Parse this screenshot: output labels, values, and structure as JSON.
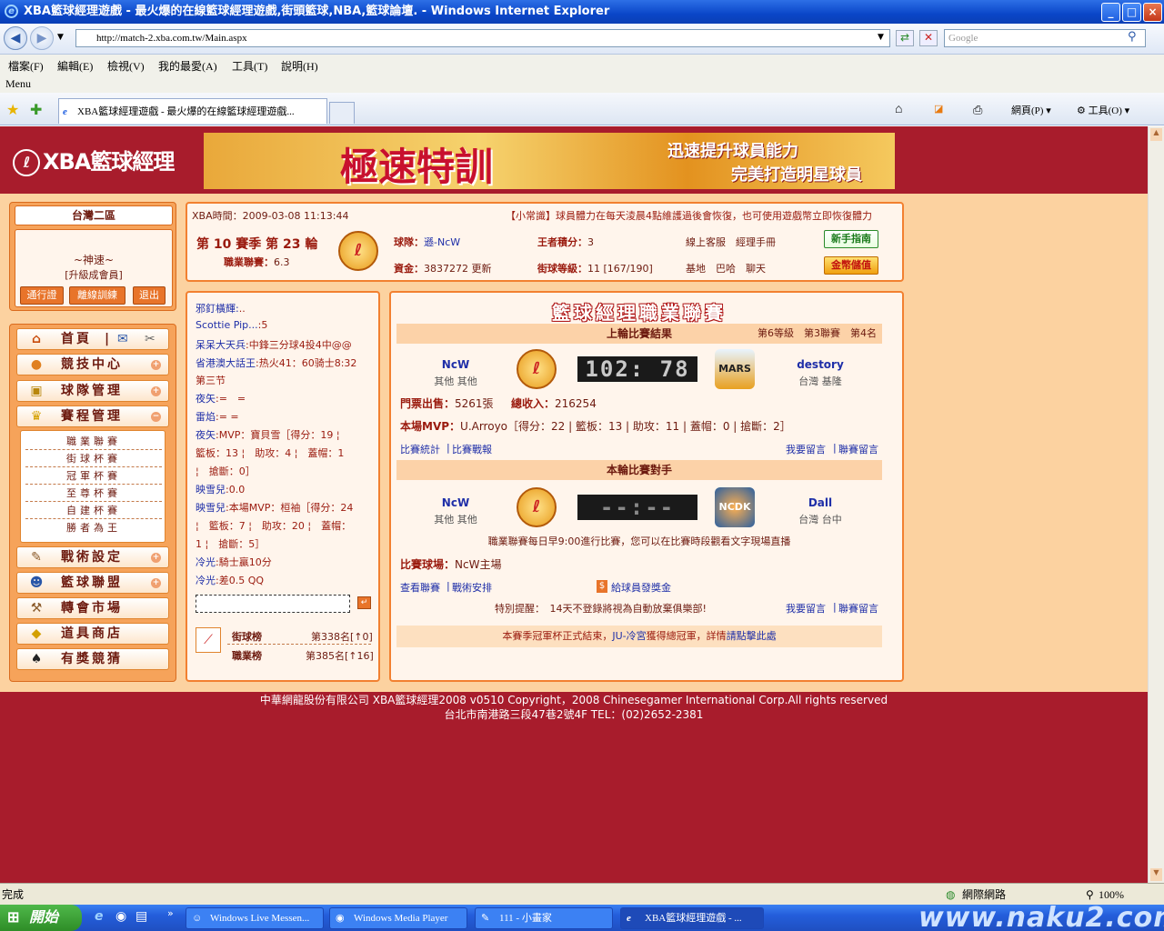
{
  "window": {
    "title": "XBA籃球經理遊戲 - 最火爆的在線籃球經理遊戲,街頭籃球,NBA,籃球論壇. - Windows Internet Explorer",
    "url": "http://match-2.xba.com.tw/Main.aspx",
    "search_placeholder": "Google",
    "menu": [
      "檔案(F)",
      "編輯(E)",
      "檢視(V)",
      "我的最愛(A)",
      "工具(T)",
      "說明(H)"
    ],
    "menu_label": "Menu",
    "tab_title": "XBA籃球經理遊戲 - 最火爆的在線籃球經理遊戲...",
    "toolbar": {
      "page": "網頁(P)",
      "tools": "工具(O)"
    }
  },
  "site": {
    "logo_text": "XBA籃球經理",
    "banner": {
      "title": "極速特訓",
      "line1": "迅速提升球員能力",
      "line2": "完美打造明星球員"
    }
  },
  "user": {
    "server": "台灣二區",
    "name": "~神速~",
    "level": "[升級成會員]",
    "buttons": [
      "通行證",
      "離線訓練",
      "退出"
    ]
  },
  "sidebar": {
    "items": [
      {
        "label": "首頁",
        "icon": "home-icon"
      },
      {
        "label": "競技中心",
        "icon": "basketball-icon"
      },
      {
        "label": "球隊管理",
        "icon": "jersey-icon"
      },
      {
        "label": "賽程管理",
        "icon": "trophy-icon"
      }
    ],
    "sub_items": [
      "職業聯賽",
      "街球杯賽",
      "冠軍杯賽",
      "至尊杯賽",
      "自建杯賽",
      "勝者為王"
    ],
    "items2": [
      {
        "label": "戰術設定",
        "icon": "tactics-icon"
      },
      {
        "label": "籃球聯盟",
        "icon": "league-icon"
      },
      {
        "label": "轉會市場",
        "icon": "hammer-icon"
      },
      {
        "label": "道具商店",
        "icon": "shop-icon"
      },
      {
        "label": "有獎競猜",
        "icon": "spade-icon"
      }
    ]
  },
  "info": {
    "time_label": "XBA時間：",
    "time": "2009-03-08 11:13:44",
    "notice": "【小常識】球員體力在每天淩晨4點維護過後會恢復，也可使用遊戲幣立即恢復體力",
    "season": "第 10 賽季 第 23 輪",
    "league_label": "職業聯賽：",
    "league_value": "6.3",
    "team_label": "球隊：",
    "team": "遜-NcW",
    "funds_label": "資金：",
    "funds": "3837272",
    "update": "更新",
    "king_label": "王者積分：",
    "king": "3",
    "street_label": "街球等級：",
    "street": "11 [167/190]",
    "links1": "線上客服　經理手冊",
    "links2": "基地　巴哈　聊天",
    "btn_guide": "新手指南",
    "btn_coin": "金幣儲值"
  },
  "chat": {
    "lines": [
      {
        "name": "邪釘橫輝:",
        "text": ".."
      },
      {
        "name": "Scottie Pip...",
        "text": ":5"
      },
      {
        "name": "呆呆大天兵",
        "text": ":中鋒三分球4投4中@@"
      },
      {
        "name": "省港澳大話王",
        "text": ":热火41：60骑士8:32"
      },
      {
        "name": "",
        "text": "第三节"
      },
      {
        "name": "夜矢",
        "text": ":=　="
      },
      {
        "name": "雷焰",
        "text": ":= ="
      },
      {
        "name": "夜矢",
        "text": ":MVP：寶貝雪［得分：19 ¦"
      },
      {
        "name": "",
        "text": "籃板：13 ¦　助攻：4 ¦　蓋帽：1"
      },
      {
        "name": "",
        "text": "¦　搶斷：0］"
      },
      {
        "name": "映雪兒",
        "text": ":0.0"
      },
      {
        "name": "映雪兒",
        "text": ":本場MVP：桓袖［得分：24"
      },
      {
        "name": "",
        "text": "¦　籃板：7 ¦　助攻：20 ¦　蓋帽："
      },
      {
        "name": "",
        "text": "1 ¦　搶斷：5］"
      },
      {
        "name": "冷光",
        "text": ":騎士贏10分"
      },
      {
        "name": "冷光",
        "text": ":差0.5 QQ"
      }
    ],
    "rank1_label": "街球榜",
    "rank1_value": "第338名[↑0]",
    "rank2_label": "職業榜",
    "rank2_value": "第385名[↑16]"
  },
  "match": {
    "title": "籃球經理職業聯賽",
    "last_header": "上輪比賽結果",
    "standing": "第6等級　第3聯賽　第4名",
    "home_name": "NcW",
    "home_loc": "其他 其他",
    "last_score": "102: 78",
    "away_name": "destory",
    "away_loc": "台灣 基隆",
    "away_logo": "MARS",
    "tickets_label": "門票出售：",
    "tickets": "5261張",
    "income_label": "總收入：",
    "income": "216254",
    "mvp_label": "本場MVP：",
    "mvp": "U.Arroyo［得分：22 | 籃板：13 | 助攻：11 | 蓋帽：0 | 搶斷：2］",
    "link_stats": "比賽統計",
    "link_report": "比賽戰報",
    "link_msg": "我要留言",
    "link_league_msg": "聯賽留言",
    "next_header": "本輪比賽對手",
    "next_score": "--:--",
    "next_away": "Dall",
    "next_away_loc": "台灣 台中",
    "next_away_logo": "NCDK",
    "schedule_note": "職業聯賽每日早9:00進行比賽，您可以在比賽時段觀看文字現場直播",
    "venue_label": "比賽球場：",
    "venue": "NcW主場",
    "link_view": "查看聯賽",
    "link_tactics": "戰術安排",
    "link_bonus": "給球員發獎金",
    "reminder": "特別提醒：　14天不登錄將視為自動放棄俱樂部!",
    "champ_pre": "本賽季冠軍杯正式結束，",
    "champ_link": "JU-冷宮",
    "champ_mid": "獲得總冠軍，詳情",
    "champ_click": "請點擊此處"
  },
  "footer": {
    "line1": "中華網龍股份有限公司  XBA籃球經理2008 v0510     Copyright，2008 Chinesegamer International Corp.All rights reserved",
    "line2": "台北市南港路三段47巷2號4F TEL：(02)2652-2381"
  },
  "statusbar": {
    "text": "完成",
    "zone": "網際網路",
    "zoom": "100%"
  },
  "taskbar": {
    "start": "開始",
    "tasks": [
      "Windows Live Messen...",
      "Windows Media Player",
      "111 - 小畫家",
      "XBA籃球經理遊戲 - ..."
    ],
    "watermark": "www.naku2.com"
  }
}
